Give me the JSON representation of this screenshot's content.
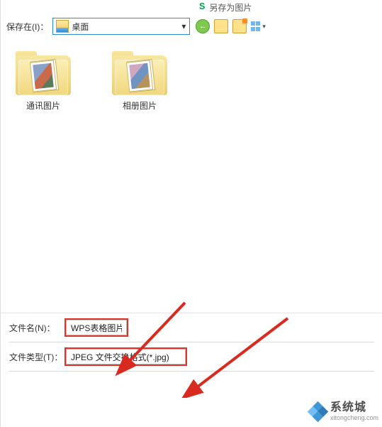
{
  "dialog": {
    "title_icon_text": "S",
    "title": "另存为图片",
    "save_in_label": "保存在(I)：",
    "location": "桌面"
  },
  "folders": [
    {
      "name": "通讯图片"
    },
    {
      "name": "相册图片"
    }
  ],
  "filename": {
    "label": "文件名(N)：",
    "value": "WPS表格图片"
  },
  "filetype": {
    "label": "文件类型(T)：",
    "value": "JPEG 文件交换格式(*.jpg)"
  },
  "watermark": {
    "main": "系统城",
    "sub": "xitongcheng.com"
  }
}
